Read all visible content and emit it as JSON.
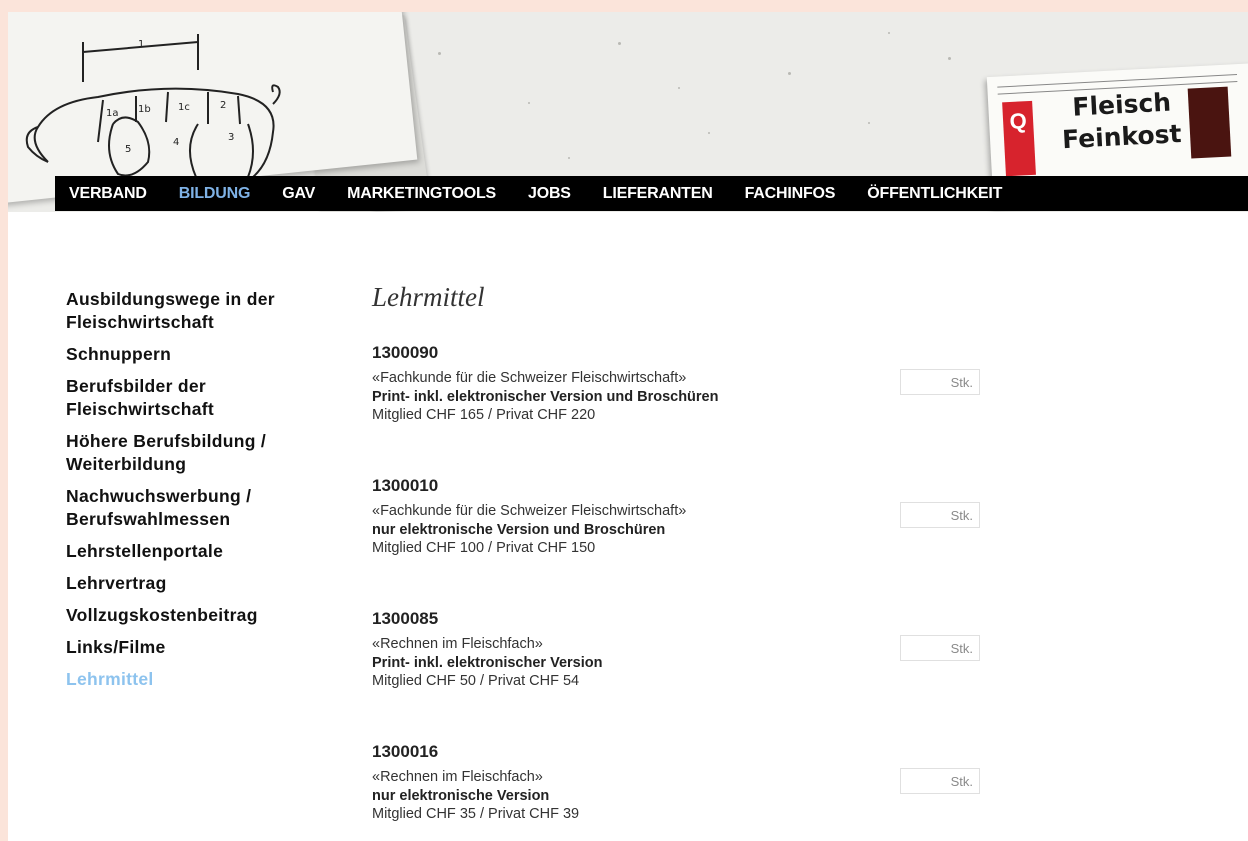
{
  "header": {
    "newspaper_title_line1": "Fleisch",
    "newspaper_title_line2": "Feinkost",
    "newspaper_logo_letter": "Q"
  },
  "nav": {
    "items": [
      {
        "label": "VERBAND",
        "active": false
      },
      {
        "label": "BILDUNG",
        "active": true
      },
      {
        "label": "GAV",
        "active": false
      },
      {
        "label": "MARKETINGTOOLS",
        "active": false
      },
      {
        "label": "JOBS",
        "active": false
      },
      {
        "label": "LIEFERANTEN",
        "active": false
      },
      {
        "label": "FACHINFOS",
        "active": false
      },
      {
        "label": "ÖFFENTLICHKEIT",
        "active": false
      }
    ],
    "active_color": "#7fb2e6"
  },
  "sidebar": {
    "items": [
      {
        "label": "Ausbildungswege in der Fleischwirtschaft"
      },
      {
        "label": "Schnuppern"
      },
      {
        "label": "Berufsbilder der Fleischwirtschaft"
      },
      {
        "label": "Höhere Berufsbildung / Weiterbildung"
      },
      {
        "label": "Nachwuchswerbung / Berufswahlmessen"
      },
      {
        "label": "Lehrstellenportale"
      },
      {
        "label": "Lehrvertrag"
      },
      {
        "label": "Vollzugskostenbeitrag"
      },
      {
        "label": "Links/Filme"
      },
      {
        "label": "Lehrmittel"
      }
    ],
    "active_color": "#8dc3ee"
  },
  "main": {
    "title": "Lehrmittel",
    "products": [
      {
        "code": "1300090",
        "name": "«Fachkunde für die Schweizer Fleischwirtschaft»",
        "variant": "Print- inkl. elektronischer Version und Broschüren",
        "price": "Mitglied CHF 165 / Privat CHF 220",
        "qty_value": "",
        "qty_placeholder": "Stk."
      },
      {
        "code": "1300010",
        "name": "«Fachkunde für die Schweizer Fleischwirtschaft»",
        "variant": "nur elektronische Version und Broschüren",
        "price": "Mitglied CHF 100 / Privat CHF 150",
        "qty_value": "",
        "qty_placeholder": "Stk."
      },
      {
        "code": "1300085",
        "name": "«Rechnen im Fleischfach»",
        "variant": "Print- inkl. elektronischer Version",
        "price": "Mitglied CHF 50 / Privat CHF 54",
        "qty_value": "",
        "qty_placeholder": "Stk."
      },
      {
        "code": "1300016",
        "name": "«Rechnen im Fleischfach»",
        "variant": "nur elektronische Version",
        "price": "Mitglied CHF 35 / Privat CHF 39",
        "qty_value": "",
        "qty_placeholder": "Stk."
      }
    ]
  },
  "colors": {
    "page_background": "#fbe4da",
    "nav_background": "#000000"
  }
}
